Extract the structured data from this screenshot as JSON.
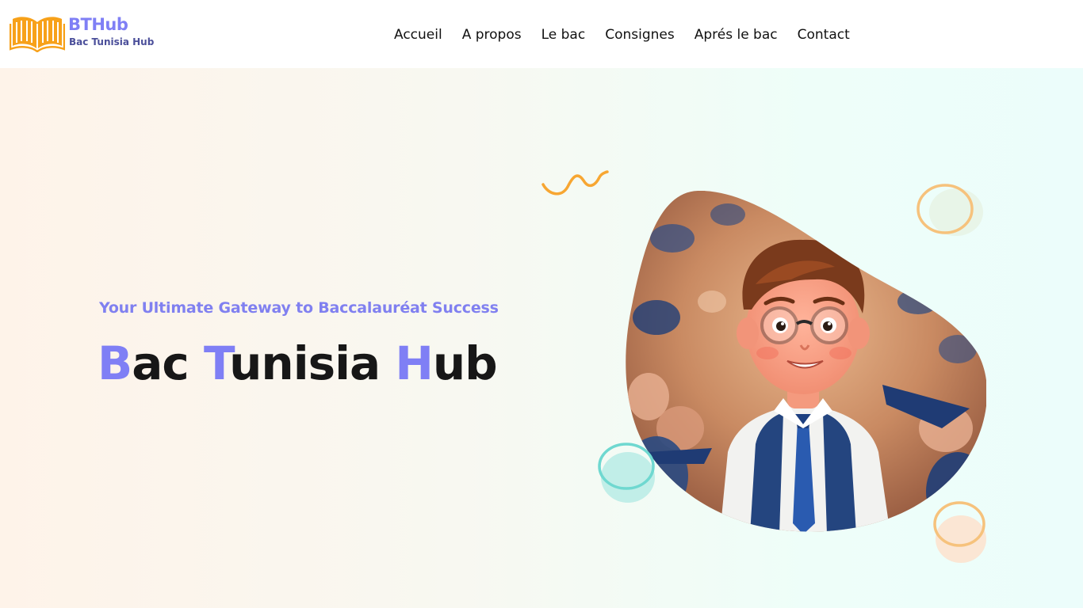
{
  "brand": {
    "name": "BTHub",
    "subtitle": "Bac Tunisia Hub",
    "logo_icon": "open-book-icon"
  },
  "nav": {
    "items": [
      {
        "label": "Accueil"
      },
      {
        "label": "A propos"
      },
      {
        "label": "Le bac"
      },
      {
        "label": "Consignes"
      },
      {
        "label": "Aprés le bac"
      },
      {
        "label": "Contact"
      }
    ]
  },
  "hero": {
    "tagline": "Your Ultimate Gateway to Baccalauréat Success",
    "title_parts": [
      {
        "text": "B",
        "accent": true
      },
      {
        "text": "ac ",
        "accent": false
      },
      {
        "text": "T",
        "accent": true
      },
      {
        "text": "unisia ",
        "accent": false
      },
      {
        "text": "H",
        "accent": true
      },
      {
        "text": "ub",
        "accent": false
      }
    ],
    "illustration": "graduate-student-illustration"
  },
  "colors": {
    "accent": "#7f7ff5",
    "logo_orange": "#f7a11a",
    "title_dark": "#171717",
    "deco_orange": "#f6c27c",
    "deco_teal": "#6fd8d0"
  }
}
